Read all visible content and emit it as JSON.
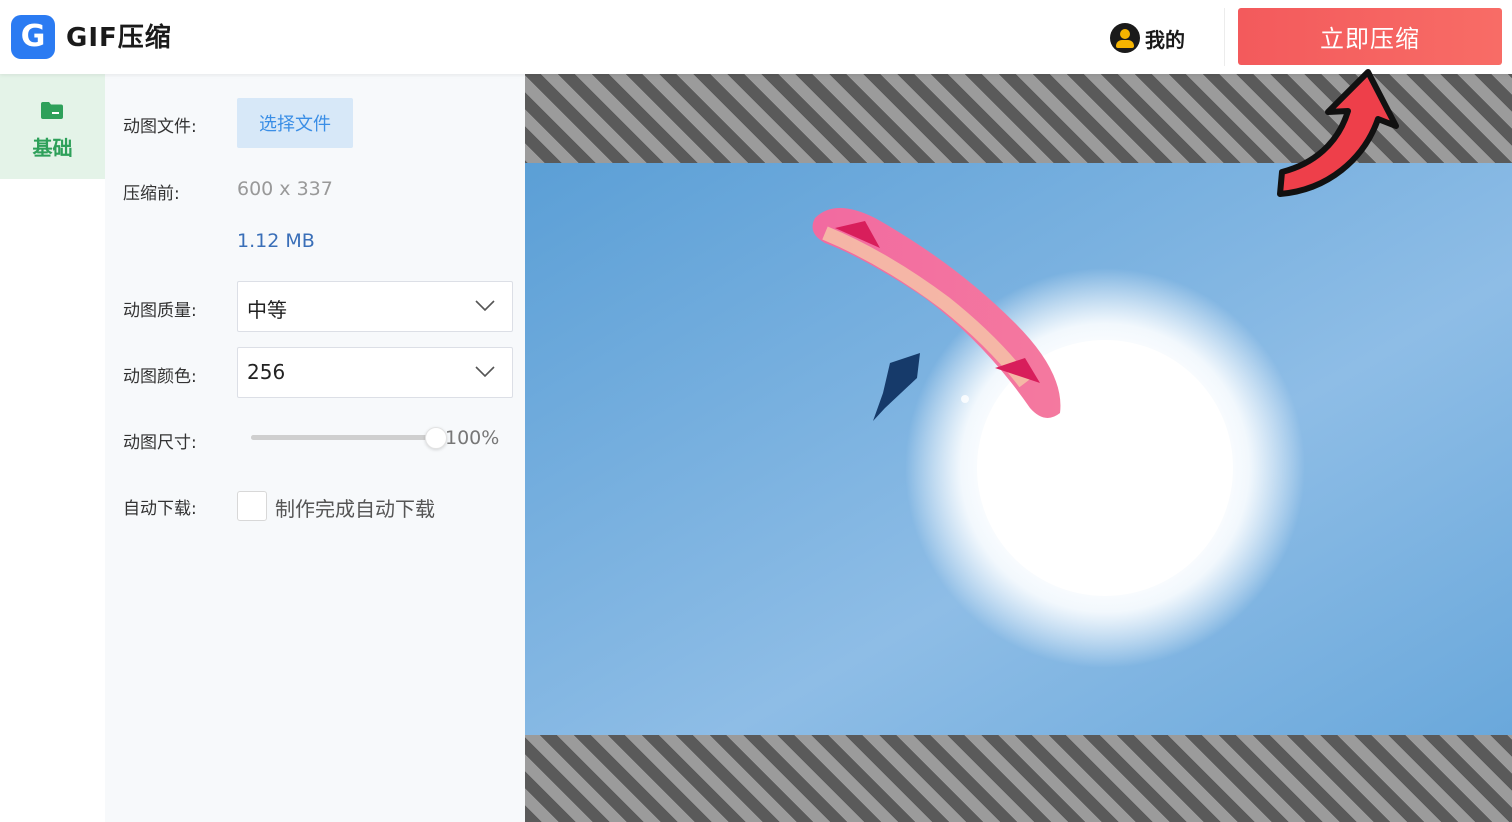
{
  "header": {
    "logo_letter": "G",
    "app_title": "GIF压缩",
    "user_label": "我的",
    "compress_button": "立即压缩"
  },
  "sidebar": {
    "items": [
      {
        "label": "基础",
        "icon": "folder-icon",
        "active": true
      }
    ]
  },
  "settings": {
    "file": {
      "label": "动图文件:",
      "button": "选择文件"
    },
    "before": {
      "label": "压缩前:",
      "dimensions": "600 x 337",
      "size": "1.12 MB"
    },
    "quality": {
      "label": "动图质量:",
      "value": "中等"
    },
    "colors": {
      "label": "动图颜色:",
      "value": "256"
    },
    "dimension_scale": {
      "label": "动图尺寸:",
      "value_text": "100%",
      "percent": 100
    },
    "auto_download": {
      "label": "自动下载:",
      "checkbox_label": "制作完成自动下载",
      "checked": false
    }
  },
  "colors": {
    "primary_button": "#f35a5c",
    "logo": "#2b7bf2",
    "sidebar_active_bg": "#e4f3e8",
    "sidebar_active_text": "#2ea05a",
    "file_button_bg": "#d7e8f8",
    "link_blue": "#3a8ee6",
    "arrow": "#ee3f4a"
  }
}
